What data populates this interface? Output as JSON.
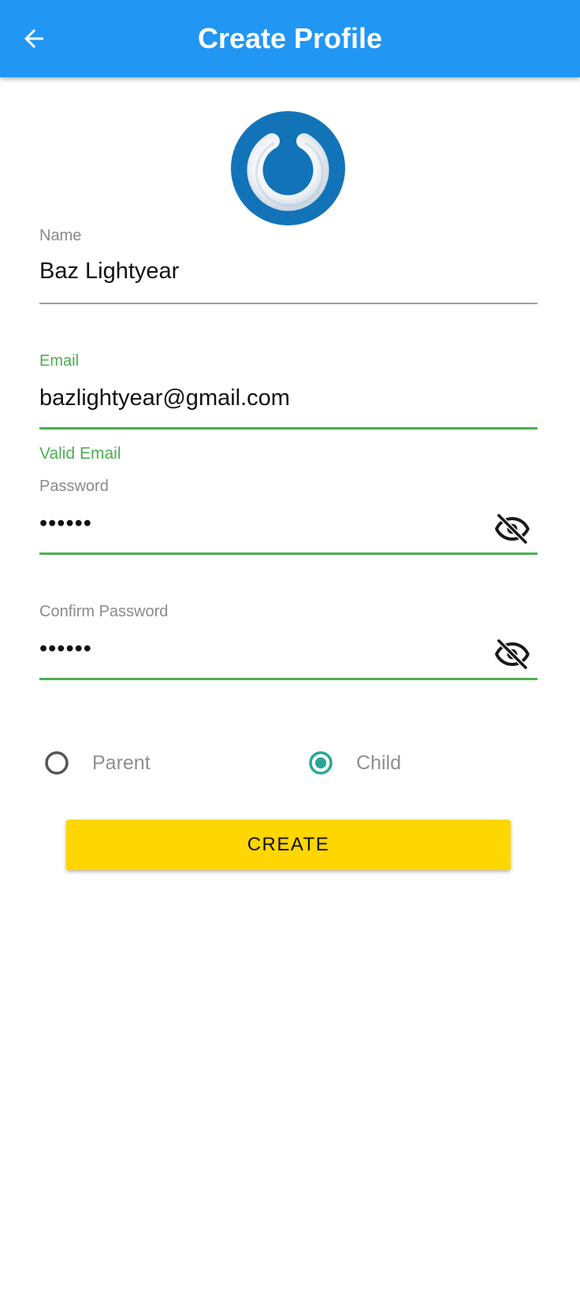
{
  "appbar": {
    "title": "Create Profile",
    "back_icon": "arrow-back-icon",
    "color": "#2196F3"
  },
  "logo": {
    "icon": "power-logo-icon",
    "color": "#1273B8"
  },
  "form": {
    "name": {
      "label": "Name",
      "value": "Baz Lightyear"
    },
    "email": {
      "label": "Email",
      "value": "bazlightyear@gmail.com",
      "helper": "Valid Email",
      "status_color": "#4CAF50"
    },
    "password": {
      "label": "Password",
      "value": "••••••",
      "toggle_icon": "visibility-off-icon"
    },
    "confirm_password": {
      "label": "Confirm Password",
      "value": "••••••",
      "toggle_icon": "visibility-off-icon"
    }
  },
  "role": {
    "options": [
      {
        "label": "Parent",
        "selected": false
      },
      {
        "label": "Child",
        "selected": true
      }
    ],
    "accent": "#26A69A"
  },
  "actions": {
    "create_label": "CREATE",
    "create_color": "#FFD600"
  }
}
